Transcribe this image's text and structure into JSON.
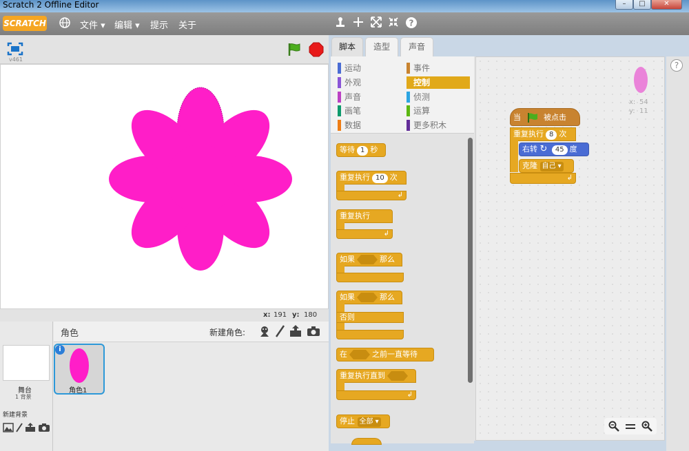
{
  "window": {
    "title": "Scratch 2 Offline Editor",
    "controls": [
      "–",
      "□",
      "✕"
    ]
  },
  "menubar": {
    "logo": "SCRATCH",
    "items": [
      "文件 ▾",
      "编辑 ▾",
      "提示",
      "关于"
    ]
  },
  "stage": {
    "version": "v461",
    "mouse_x_label": "x:",
    "mouse_x": "191",
    "mouse_y_label": "y:",
    "mouse_y": "180",
    "flower_color": "#ff1ec8"
  },
  "sprites": {
    "header": "角色",
    "new_sprite_label": "新建角色:",
    "stage_label": "舞台",
    "stage_backdrops": "1 背景",
    "new_backdrop_label": "新建背景",
    "selected_sprite": "角色1"
  },
  "tabs": [
    "脚本",
    "造型",
    "声音"
  ],
  "categories": {
    "left": [
      {
        "label": "运动",
        "color": "#4a6cd4"
      },
      {
        "label": "外观",
        "color": "#8a55d7"
      },
      {
        "label": "声音",
        "color": "#bb42c3"
      },
      {
        "label": "画笔",
        "color": "#0e9a6c"
      },
      {
        "label": "数据",
        "color": "#ee7d16"
      }
    ],
    "right": [
      {
        "label": "事件",
        "color": "#c88330"
      },
      {
        "label": "控制",
        "color": "#e1a91a"
      },
      {
        "label": "侦测",
        "color": "#2ca5e2"
      },
      {
        "label": "运算",
        "color": "#5cb712"
      },
      {
        "label": "更多积木",
        "color": "#632d99"
      }
    ]
  },
  "palette": {
    "wait": {
      "text": "等待",
      "value": "1",
      "unit": "秒"
    },
    "repeat": {
      "text": "重复执行",
      "value": "10",
      "unit": "次"
    },
    "forever": "重复执行",
    "if_then": {
      "text": "如果",
      "then": "那么"
    },
    "if_else": {
      "text": "如果",
      "then": "那么",
      "else": "否则"
    },
    "wait_until": {
      "text": "在",
      "tail": "之前一直等待"
    },
    "repeat_until": "重复执行直到",
    "stop": {
      "text": "停止",
      "option": "全部"
    }
  },
  "script": {
    "hat": {
      "when": "当",
      "clicked": "被点击"
    },
    "repeat": {
      "text": "重复执行",
      "value": "8",
      "unit": "次"
    },
    "turn": {
      "text": "右转",
      "value": "45",
      "unit": "度"
    },
    "clone": {
      "text": "克隆",
      "option": "自己"
    }
  },
  "sprite_info": {
    "x_label": "x:",
    "x": "54",
    "y_label": "y:",
    "y": "11"
  }
}
